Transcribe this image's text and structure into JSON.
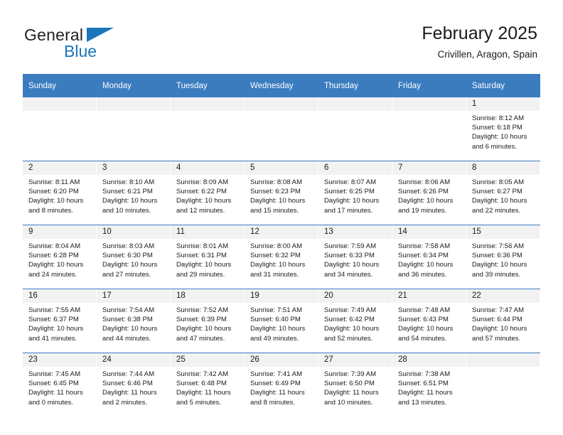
{
  "brand": {
    "name_part1": "General",
    "name_part2": "Blue",
    "logo_icon": "blue-triangle-icon"
  },
  "header": {
    "title": "February 2025",
    "subtitle": "Crivillen, Aragon, Spain"
  },
  "colors": {
    "header_blue": "#3b7cbf",
    "brand_blue": "#1b75bb",
    "daynum_band": "#f2f2f2",
    "text": "#1a1a1a"
  },
  "weekday_headers": [
    "Sunday",
    "Monday",
    "Tuesday",
    "Wednesday",
    "Thursday",
    "Friday",
    "Saturday"
  ],
  "labels": {
    "sunrise_prefix": "Sunrise: ",
    "sunset_prefix": "Sunset: ",
    "daylight_prefix": "Daylight: "
  },
  "weeks": [
    {
      "days": [
        {
          "date": "",
          "blank": true
        },
        {
          "date": "",
          "blank": true
        },
        {
          "date": "",
          "blank": true
        },
        {
          "date": "",
          "blank": true
        },
        {
          "date": "",
          "blank": true
        },
        {
          "date": "",
          "blank": true
        },
        {
          "date": "1",
          "sunrise": "Sunrise: 8:12 AM",
          "sunset": "Sunset: 6:18 PM",
          "daylight_line1": "Daylight: 10 hours",
          "daylight_line2": "and 6 minutes."
        }
      ]
    },
    {
      "days": [
        {
          "date": "2",
          "sunrise": "Sunrise: 8:11 AM",
          "sunset": "Sunset: 6:20 PM",
          "daylight_line1": "Daylight: 10 hours",
          "daylight_line2": "and 8 minutes."
        },
        {
          "date": "3",
          "sunrise": "Sunrise: 8:10 AM",
          "sunset": "Sunset: 6:21 PM",
          "daylight_line1": "Daylight: 10 hours",
          "daylight_line2": "and 10 minutes."
        },
        {
          "date": "4",
          "sunrise": "Sunrise: 8:09 AM",
          "sunset": "Sunset: 6:22 PM",
          "daylight_line1": "Daylight: 10 hours",
          "daylight_line2": "and 12 minutes."
        },
        {
          "date": "5",
          "sunrise": "Sunrise: 8:08 AM",
          "sunset": "Sunset: 6:23 PM",
          "daylight_line1": "Daylight: 10 hours",
          "daylight_line2": "and 15 minutes."
        },
        {
          "date": "6",
          "sunrise": "Sunrise: 8:07 AM",
          "sunset": "Sunset: 6:25 PM",
          "daylight_line1": "Daylight: 10 hours",
          "daylight_line2": "and 17 minutes."
        },
        {
          "date": "7",
          "sunrise": "Sunrise: 8:06 AM",
          "sunset": "Sunset: 6:26 PM",
          "daylight_line1": "Daylight: 10 hours",
          "daylight_line2": "and 19 minutes."
        },
        {
          "date": "8",
          "sunrise": "Sunrise: 8:05 AM",
          "sunset": "Sunset: 6:27 PM",
          "daylight_line1": "Daylight: 10 hours",
          "daylight_line2": "and 22 minutes."
        }
      ]
    },
    {
      "days": [
        {
          "date": "9",
          "sunrise": "Sunrise: 8:04 AM",
          "sunset": "Sunset: 6:28 PM",
          "daylight_line1": "Daylight: 10 hours",
          "daylight_line2": "and 24 minutes."
        },
        {
          "date": "10",
          "sunrise": "Sunrise: 8:03 AM",
          "sunset": "Sunset: 6:30 PM",
          "daylight_line1": "Daylight: 10 hours",
          "daylight_line2": "and 27 minutes."
        },
        {
          "date": "11",
          "sunrise": "Sunrise: 8:01 AM",
          "sunset": "Sunset: 6:31 PM",
          "daylight_line1": "Daylight: 10 hours",
          "daylight_line2": "and 29 minutes."
        },
        {
          "date": "12",
          "sunrise": "Sunrise: 8:00 AM",
          "sunset": "Sunset: 6:32 PM",
          "daylight_line1": "Daylight: 10 hours",
          "daylight_line2": "and 31 minutes."
        },
        {
          "date": "13",
          "sunrise": "Sunrise: 7:59 AM",
          "sunset": "Sunset: 6:33 PM",
          "daylight_line1": "Daylight: 10 hours",
          "daylight_line2": "and 34 minutes."
        },
        {
          "date": "14",
          "sunrise": "Sunrise: 7:58 AM",
          "sunset": "Sunset: 6:34 PM",
          "daylight_line1": "Daylight: 10 hours",
          "daylight_line2": "and 36 minutes."
        },
        {
          "date": "15",
          "sunrise": "Sunrise: 7:56 AM",
          "sunset": "Sunset: 6:36 PM",
          "daylight_line1": "Daylight: 10 hours",
          "daylight_line2": "and 39 minutes."
        }
      ]
    },
    {
      "days": [
        {
          "date": "16",
          "sunrise": "Sunrise: 7:55 AM",
          "sunset": "Sunset: 6:37 PM",
          "daylight_line1": "Daylight: 10 hours",
          "daylight_line2": "and 41 minutes."
        },
        {
          "date": "17",
          "sunrise": "Sunrise: 7:54 AM",
          "sunset": "Sunset: 6:38 PM",
          "daylight_line1": "Daylight: 10 hours",
          "daylight_line2": "and 44 minutes."
        },
        {
          "date": "18",
          "sunrise": "Sunrise: 7:52 AM",
          "sunset": "Sunset: 6:39 PM",
          "daylight_line1": "Daylight: 10 hours",
          "daylight_line2": "and 47 minutes."
        },
        {
          "date": "19",
          "sunrise": "Sunrise: 7:51 AM",
          "sunset": "Sunset: 6:40 PM",
          "daylight_line1": "Daylight: 10 hours",
          "daylight_line2": "and 49 minutes."
        },
        {
          "date": "20",
          "sunrise": "Sunrise: 7:49 AM",
          "sunset": "Sunset: 6:42 PM",
          "daylight_line1": "Daylight: 10 hours",
          "daylight_line2": "and 52 minutes."
        },
        {
          "date": "21",
          "sunrise": "Sunrise: 7:48 AM",
          "sunset": "Sunset: 6:43 PM",
          "daylight_line1": "Daylight: 10 hours",
          "daylight_line2": "and 54 minutes."
        },
        {
          "date": "22",
          "sunrise": "Sunrise: 7:47 AM",
          "sunset": "Sunset: 6:44 PM",
          "daylight_line1": "Daylight: 10 hours",
          "daylight_line2": "and 57 minutes."
        }
      ]
    },
    {
      "days": [
        {
          "date": "23",
          "sunrise": "Sunrise: 7:45 AM",
          "sunset": "Sunset: 6:45 PM",
          "daylight_line1": "Daylight: 11 hours",
          "daylight_line2": "and 0 minutes."
        },
        {
          "date": "24",
          "sunrise": "Sunrise: 7:44 AM",
          "sunset": "Sunset: 6:46 PM",
          "daylight_line1": "Daylight: 11 hours",
          "daylight_line2": "and 2 minutes."
        },
        {
          "date": "25",
          "sunrise": "Sunrise: 7:42 AM",
          "sunset": "Sunset: 6:48 PM",
          "daylight_line1": "Daylight: 11 hours",
          "daylight_line2": "and 5 minutes."
        },
        {
          "date": "26",
          "sunrise": "Sunrise: 7:41 AM",
          "sunset": "Sunset: 6:49 PM",
          "daylight_line1": "Daylight: 11 hours",
          "daylight_line2": "and 8 minutes."
        },
        {
          "date": "27",
          "sunrise": "Sunrise: 7:39 AM",
          "sunset": "Sunset: 6:50 PM",
          "daylight_line1": "Daylight: 11 hours",
          "daylight_line2": "and 10 minutes."
        },
        {
          "date": "28",
          "sunrise": "Sunrise: 7:38 AM",
          "sunset": "Sunset: 6:51 PM",
          "daylight_line1": "Daylight: 11 hours",
          "daylight_line2": "and 13 minutes."
        },
        {
          "date": "",
          "blank": true
        }
      ]
    }
  ]
}
